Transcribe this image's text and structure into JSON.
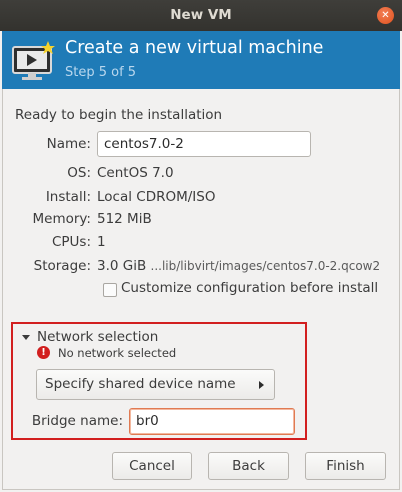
{
  "window": {
    "title": "New VM"
  },
  "banner": {
    "title": "Create a new virtual machine",
    "step": "Step 5 of 5"
  },
  "summary": {
    "heading": "Ready to begin the installation",
    "name_label": "Name:",
    "name_value": "centos7.0-2",
    "os_label": "OS:",
    "os_value": "CentOS 7.0",
    "install_label": "Install:",
    "install_value": "Local CDROM/ISO",
    "memory_label": "Memory:",
    "memory_value": "512 MiB",
    "cpus_label": "CPUs:",
    "cpus_value": "1",
    "storage_label": "Storage:",
    "storage_size": "3.0 GiB",
    "storage_path": "...lib/libvirt/images/centos7.0-2.qcow2",
    "customize_label": "Customize configuration before install",
    "customize_checked": false
  },
  "network": {
    "title": "Network selection",
    "error": "No network selected",
    "source": "Specify shared device name",
    "bridge_label": "Bridge name:",
    "bridge_value": "br0"
  },
  "buttons": {
    "cancel": "Cancel",
    "back": "Back",
    "finish": "Finish"
  },
  "colors": {
    "banner": "#1f7bb7",
    "highlight_box": "#d21f1f",
    "titlebar": "#3a3935"
  },
  "icons": {
    "close": "close-icon",
    "vm": "monitor-icon",
    "error": "error-icon"
  }
}
